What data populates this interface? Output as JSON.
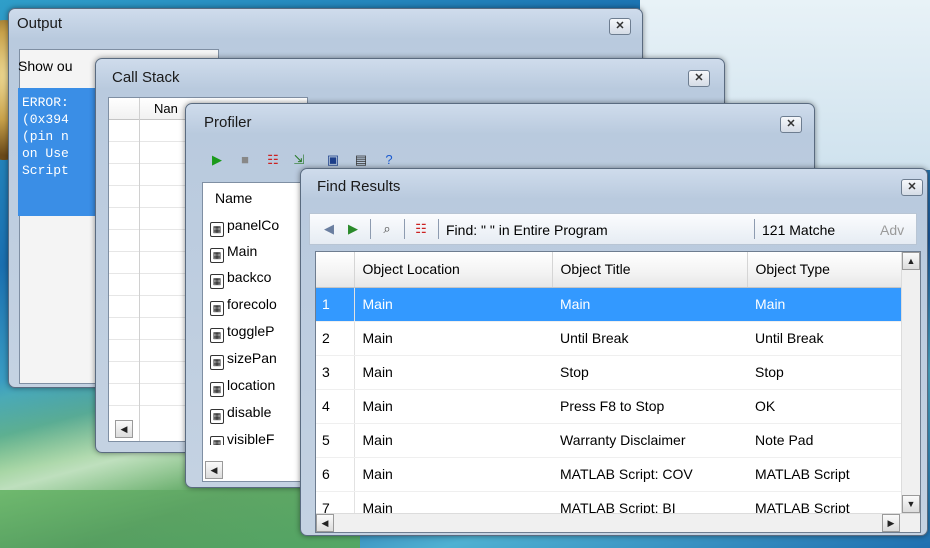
{
  "windows": {
    "output": {
      "title": "Output",
      "show_label": "Show ou",
      "text_lines": "ERROR:\n(0x394\n(pin n\non Use\nScript"
    },
    "call_stack": {
      "title": "Call Stack",
      "column_name": "Nan"
    },
    "profiler": {
      "title": "Profiler",
      "column_name": "Name",
      "items": [
        "panelCo",
        "Main",
        "backco",
        "forecolo",
        "toggleP",
        "sizePan",
        "location",
        "disable",
        "visibleF"
      ]
    },
    "find_results": {
      "title": "Find Results",
      "find_label": "Find: \" \"  in  Entire Program",
      "matches_label": "121 Matche",
      "adv_label": "Adv",
      "columns": [
        "",
        "Object Location",
        "Object Title",
        "Object Type"
      ],
      "rows": [
        [
          "1",
          "Main",
          "Main",
          "Main"
        ],
        [
          "2",
          "Main",
          "Until Break",
          "Until Break"
        ],
        [
          "3",
          "Main",
          "Stop",
          "Stop"
        ],
        [
          "4",
          "Main",
          "Press F8 to Stop",
          "OK"
        ],
        [
          "5",
          "Main",
          "Warranty Disclaimer",
          "Note Pad"
        ],
        [
          "6",
          "Main",
          "MATLAB Script: COV",
          "MATLAB Script"
        ],
        [
          "7",
          "Main",
          "MATLAB Script: BI",
          "MATLAB Script"
        ]
      ],
      "selected_row": 0
    }
  },
  "icons": {
    "close": "close-icon",
    "play": "play-icon",
    "stop": "stop-icon",
    "find": "binoculars-icon",
    "clear": "clear-results-icon"
  },
  "colors": {
    "selection": "#3399ff",
    "output_text_bg": "#3a8ee6"
  }
}
